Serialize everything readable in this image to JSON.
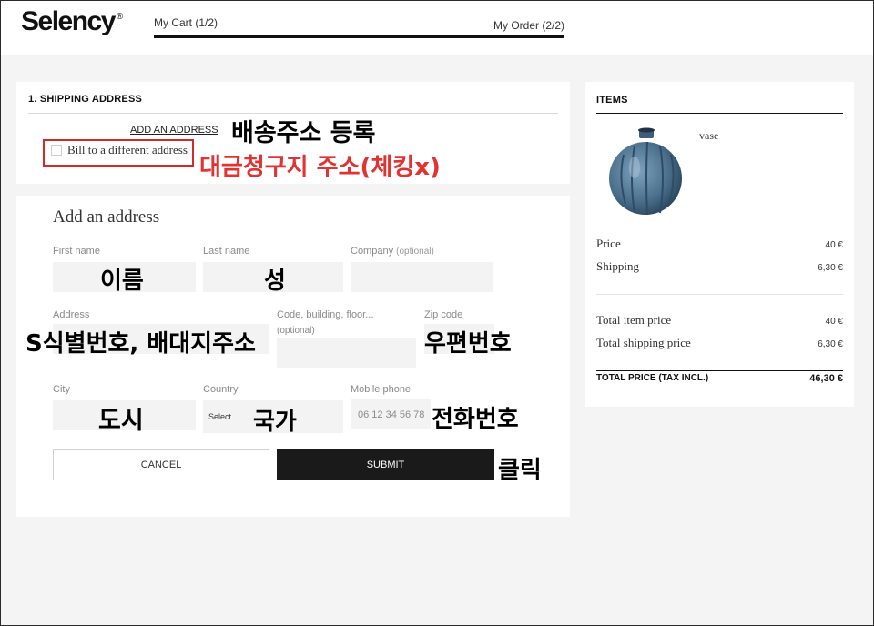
{
  "header": {
    "logo": "Selency",
    "logo_mark": "®",
    "step_cart": "My Cart (1/2)",
    "step_order": "My Order (2/2)"
  },
  "shipping": {
    "title": "1. SHIPPING ADDRESS",
    "add_address_link": "ADD AN ADDRESS",
    "bill_label": "Bill to a different address"
  },
  "form": {
    "heading": "Add an address",
    "first_name_label": "First name",
    "last_name_label": "Last name",
    "company_label": "Company",
    "company_optional": "(optional)",
    "address_label": "Address",
    "building_label": "Code, building, floor...",
    "building_optional": "(optional)",
    "zip_label": "Zip code",
    "city_label": "City",
    "country_label": "Country",
    "country_value": "Select...",
    "mobile_label": "Mobile phone",
    "mobile_placeholder": "06 12 34 56 78",
    "cancel_label": "CANCEL",
    "submit_label": "SUBMIT"
  },
  "items": {
    "title": "ITEMS",
    "product_name": "vase",
    "price_label": "Price",
    "price_value": "40 €",
    "shipping_label": "Shipping",
    "shipping_value": "6,30 €",
    "total_item_label": "Total item price",
    "total_item_value": "40 €",
    "total_shipping_label": "Total shipping price",
    "total_shipping_value": "6,30 €",
    "total_label": "TOTAL PRICE (TAX INCL.)",
    "total_value": "46,30 €"
  },
  "annotations": {
    "register_address": "배송주소 등록",
    "billing_note": "대금청구지 주소(체킹x)",
    "name": "이름",
    "surname": "성",
    "address_note": "S식별번호, 배대지주소",
    "zip": "우편번호",
    "city": "도시",
    "country": "국가",
    "phone": "전화번호",
    "click": "클릭"
  },
  "colors": {
    "accent_dark": "#1a1a1a",
    "annotation_red": "#e23232",
    "page_gray": "#f4f4f4",
    "vase_blue": "#4a6f8c"
  }
}
